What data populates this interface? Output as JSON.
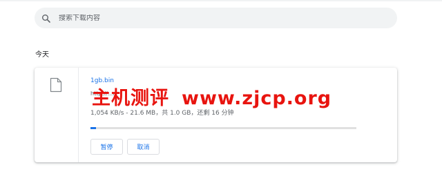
{
  "search": {
    "placeholder": "搜索下载内容"
  },
  "section": {
    "date_label": "今天"
  },
  "download": {
    "file_name": "1gb.bin",
    "source_url": "http://...n",
    "status": "1,054 KB/s - 21.6 MB，共 1.0 GB，还剩 16 分钟",
    "progress_fraction": 0.021,
    "pause_label": "暂停",
    "cancel_label": "取消"
  },
  "watermark": {
    "left_text": "主机测评",
    "right_text": "www.zjcp.org"
  },
  "colors": {
    "accent": "#1a73e8",
    "watermark": "#e8140f",
    "search_bg": "#f1f3f4"
  }
}
